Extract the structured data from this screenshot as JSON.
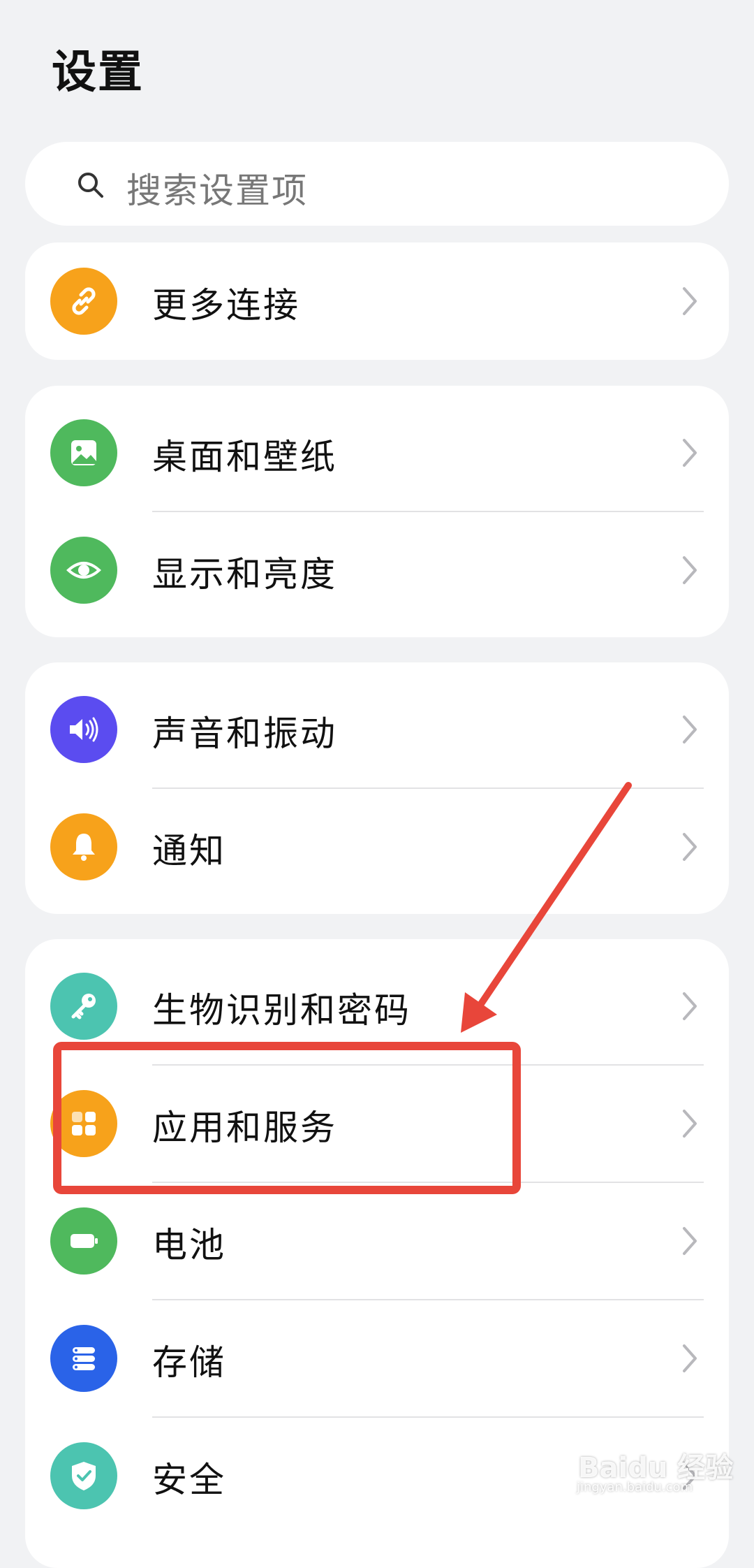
{
  "header": {
    "title": "设置"
  },
  "search": {
    "placeholder": "搜索设置项"
  },
  "groups": [
    {
      "items": [
        {
          "label": "更多连接",
          "icon": "link-icon",
          "color": "#F7A21B"
        }
      ]
    },
    {
      "items": [
        {
          "label": "桌面和壁纸",
          "icon": "image-icon",
          "color": "#4FB95D"
        },
        {
          "label": "显示和亮度",
          "icon": "eye-icon",
          "color": "#4FB95D"
        }
      ]
    },
    {
      "items": [
        {
          "label": "声音和振动",
          "icon": "speaker-icon",
          "color": "#5B4CF0"
        },
        {
          "label": "通知",
          "icon": "bell-icon",
          "color": "#F7A21B"
        }
      ]
    },
    {
      "items": [
        {
          "label": "生物识别和密码",
          "icon": "key-icon",
          "color": "#4CC4B0"
        },
        {
          "label": "应用和服务",
          "icon": "apps-grid-icon",
          "color": "#F7A21B"
        },
        {
          "label": "电池",
          "icon": "battery-icon",
          "color": "#4FB95D"
        },
        {
          "label": "存储",
          "icon": "storage-icon",
          "color": "#2A63E8"
        },
        {
          "label": "安全",
          "icon": "shield-icon",
          "color": "#4CC4B0"
        }
      ]
    }
  ],
  "annotation": {
    "color": "#E8463A"
  },
  "watermark": {
    "brand": "Baidu 经验",
    "url": "jingyan.baidu.com"
  }
}
